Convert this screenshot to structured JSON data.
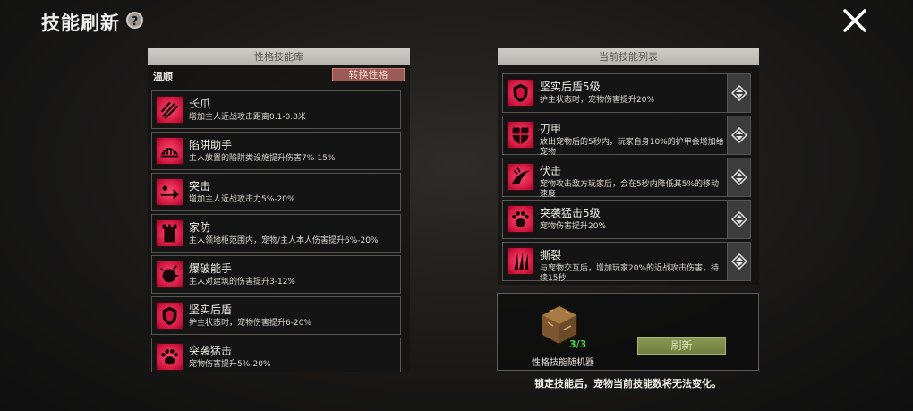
{
  "header": {
    "title": "技能刷新",
    "help_icon": "question-icon",
    "close_icon": "close-icon"
  },
  "library": {
    "title": "性格技能库",
    "personality": "温顺",
    "swap_label": "转换性格",
    "skills": [
      {
        "name": "长爪",
        "desc": "增加主人近战攻击距离0.1-0.8米",
        "icon": "claw-icon"
      },
      {
        "name": "陷阱助手",
        "desc": "主人放置的陷阱类设施提升伤害7%-15%",
        "icon": "trap-icon"
      },
      {
        "name": "突击",
        "desc": "增加主人近战攻击力5%-20%",
        "icon": "charge-icon"
      },
      {
        "name": "家防",
        "desc": "主人领地柜范围内，宠物/主人本人伤害提升6%-20%",
        "icon": "tower-icon"
      },
      {
        "name": "爆破能手",
        "desc": "主人对建筑的伤害提升3-12%",
        "icon": "bomb-icon"
      },
      {
        "name": "坚实后盾",
        "desc": "护主状态时，宠物伤害提升6-20%",
        "icon": "shield-icon"
      },
      {
        "name": "突袭猛击",
        "desc": "宠物伤害提升5%-20%",
        "icon": "paw-icon"
      }
    ]
  },
  "current": {
    "title": "当前技能列表",
    "skills": [
      {
        "name": "坚实后盾5级",
        "desc": "护主状态时，宠物伤害提升20%",
        "icon": "shield-icon"
      },
      {
        "name": "刃甲",
        "desc": "放出宠物后的5秒内，玩家自身10%的护甲会增加给宠物",
        "icon": "armor-icon"
      },
      {
        "name": "伏击",
        "desc": "宠物攻击敌方玩家后，会在5秒内降低其5%的移动速度",
        "icon": "ambush-icon"
      },
      {
        "name": "突袭猛击5级",
        "desc": "宠物伤害提升20%",
        "icon": "paw-icon"
      },
      {
        "name": "撕裂",
        "desc": "与宠物交互后，增加玩家20%的近战攻击伤害，持续15秒",
        "icon": "tear-icon"
      }
    ]
  },
  "randomizer": {
    "label": "性格技能随机器",
    "count": "3/3",
    "refresh_label": "刷新"
  },
  "footer_note": "锁定技能后，宠物当前技能数将无法变化。",
  "colors": {
    "accent_red": "#d0163f",
    "refresh_green": "#7a8a48",
    "count_green": "#4cd24c"
  }
}
